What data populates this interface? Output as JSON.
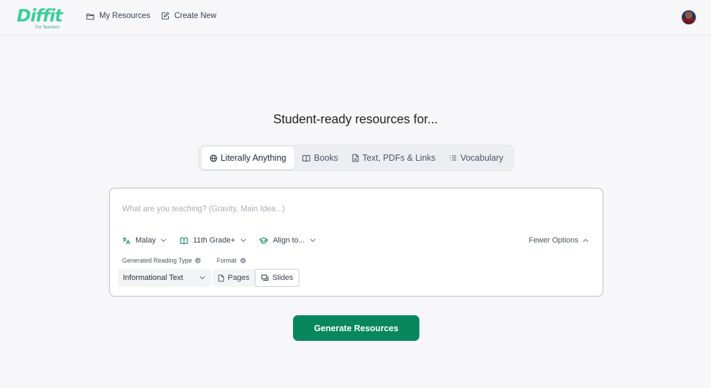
{
  "brand": {
    "logo_text": "Diffit",
    "logo_subtext": "For Teachers",
    "accent_color": "#3fcf9a",
    "primary_button_color": "#08875c"
  },
  "nav": {
    "items": [
      {
        "label": "My Resources",
        "icon": "folder-icon"
      },
      {
        "label": "Create New",
        "icon": "edit-icon"
      }
    ],
    "avatar": "user-avatar"
  },
  "hero": {
    "title": "Student-ready resources for..."
  },
  "tabs": [
    {
      "label": "Literally Anything",
      "icon": "globe-icon",
      "active": true
    },
    {
      "label": "Books",
      "icon": "book-icon",
      "active": false
    },
    {
      "label": "Text, PDFs & Links",
      "icon": "document-icon",
      "active": false
    },
    {
      "label": "Vocabulary",
      "icon": "list-icon",
      "active": false
    }
  ],
  "form": {
    "teach_placeholder": "What are you teaching? (Gravity, Main Idea...)",
    "teach_value": "",
    "language": {
      "label": "Malay",
      "icon": "translate-icon"
    },
    "grade": {
      "label": "11th Grade+",
      "icon": "book-open-icon"
    },
    "align": {
      "label": "Align to...",
      "icon": "graduation-cap-icon"
    },
    "fewer_options": "Fewer Options",
    "reading_type_label": "Generated Reading Type",
    "reading_type_value": "Informational Text",
    "format_label": "Format",
    "format_options": [
      {
        "label": "Pages",
        "icon": "page-icon",
        "selected": false
      },
      {
        "label": "Slides",
        "icon": "slides-icon",
        "selected": true
      }
    ]
  },
  "actions": {
    "generate_label": "Generate Resources"
  }
}
